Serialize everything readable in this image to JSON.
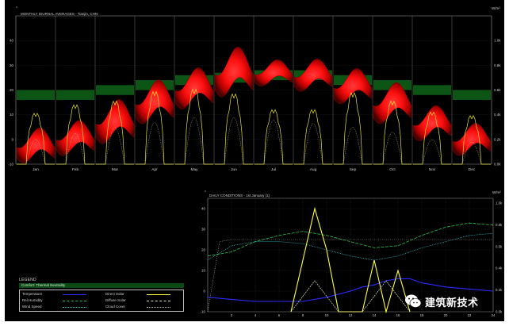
{
  "screen": {
    "background": "#000000",
    "frame": "#ffffff",
    "text": "#bdbdbd",
    "grid": "#3a3a3a"
  },
  "top": {
    "title": "MONTHLY DIURNAL AVERAGES - Tianjin, CHN",
    "left_unit": "°",
    "right_unit": "W/m²",
    "comfort_color": "#0d5a16"
  },
  "bottom": {
    "title": "DAILY CONDITIONS - 1st January (1)",
    "left_unit": "°",
    "right_unit": "W/m²"
  },
  "legend": {
    "title": "LEGEND",
    "comfort_label": "Comfort: Thermal Neutrality",
    "items": {
      "temperature": "Temperature",
      "rel_humidity": "Rel.Humidity",
      "wind_speed": "Wind Speed",
      "direct_solar": "Direct Solar",
      "diffuse_solar": "Diffuse Solar",
      "cloud_cover": "Cloud Cover"
    },
    "colors": {
      "temperature": "#2b2bff",
      "rel_humidity": "#2ec24a",
      "wind_speed": "#33c4c4",
      "direct_solar": "#ffff33",
      "diffuse_solar": "#e6e6b4",
      "cloud_cover": "#b8b8b8"
    }
  },
  "watermark": {
    "text": "建筑新技术",
    "icon": "wechat-icon"
  },
  "chart_data": [
    {
      "type": "area",
      "title": "MONTHLY DIURNAL AVERAGES - Tianjin, CHN",
      "y_ticks": [
        -10,
        0,
        10,
        20,
        30,
        40
      ],
      "y_range": [
        -10,
        50
      ],
      "y2_ticks": [
        "0.0k",
        "0.2k",
        "0.4k",
        "0.6k",
        "0.8k",
        "1.0k"
      ],
      "y2_range": [
        0,
        1.2
      ],
      "categories": [
        "Jan",
        "Feb",
        "Mar",
        "Apr",
        "May",
        "Jun",
        "Jul",
        "Aug",
        "Sep",
        "Oct",
        "Nov",
        "Dec"
      ],
      "comfort_band": [
        [
          16,
          20
        ],
        [
          16,
          20
        ],
        [
          18,
          22
        ],
        [
          20,
          24
        ],
        [
          22,
          26
        ],
        [
          23,
          27
        ],
        [
          24,
          28
        ],
        [
          24,
          28
        ],
        [
          22,
          26
        ],
        [
          20,
          24
        ],
        [
          18,
          22
        ],
        [
          16,
          20
        ]
      ],
      "temperature_range": [
        [
          -9,
          3
        ],
        [
          -6,
          6
        ],
        [
          -1,
          14
        ],
        [
          7,
          22
        ],
        [
          13,
          27
        ],
        [
          18,
          35
        ],
        [
          22,
          31
        ],
        [
          20,
          31
        ],
        [
          15,
          27
        ],
        [
          7,
          21
        ],
        [
          0,
          12
        ],
        [
          -6,
          5
        ]
      ],
      "direct_solar_peak_kwm2": [
        0.42,
        0.49,
        0.52,
        0.6,
        0.62,
        0.58,
        0.45,
        0.45,
        0.59,
        0.52,
        0.43,
        0.4
      ],
      "diffuse_solar_peak_kwm2": [
        0.2,
        0.25,
        0.3,
        0.34,
        0.38,
        0.38,
        0.36,
        0.33,
        0.3,
        0.26,
        0.2,
        0.18
      ]
    },
    {
      "type": "line",
      "title": "DAILY CONDITIONS - 1st January (1)",
      "x_ticks": [
        2,
        4,
        6,
        8,
        10,
        12,
        14,
        16,
        18,
        20,
        22,
        24
      ],
      "x_range": [
        0,
        24
      ],
      "y_ticks": [
        -10,
        0,
        10,
        20,
        30,
        40
      ],
      "y_range": [
        -10,
        45
      ],
      "y2_ticks": [
        "0.0k",
        "0.2k",
        "0.4k",
        "0.6k",
        "0.8k",
        "1.0k"
      ],
      "series": [
        {
          "name": "Temperature",
          "x": [
            0,
            2,
            4,
            6,
            8,
            10,
            12,
            13,
            14,
            15,
            16,
            17,
            18,
            20,
            22,
            24
          ],
          "y": [
            -3,
            -4,
            -5,
            -5,
            -5,
            -3,
            0,
            2,
            3,
            5,
            6,
            6,
            4,
            2,
            1,
            0
          ]
        },
        {
          "name": "Rel.Humidity",
          "x": [
            0,
            2,
            4,
            6,
            8,
            10,
            12,
            14,
            16,
            18,
            20,
            22,
            24
          ],
          "y": [
            17,
            19,
            24,
            27,
            29,
            27,
            24,
            21,
            22,
            27,
            31,
            33,
            32
          ]
        },
        {
          "name": "Wind Speed",
          "x": [
            0,
            2,
            4,
            6,
            8,
            10,
            12,
            14,
            16,
            18,
            20,
            22,
            24
          ],
          "y": [
            15,
            22,
            24,
            24,
            23,
            20,
            17,
            15,
            17,
            21,
            24,
            27,
            28
          ]
        },
        {
          "name": "Direct Solar",
          "x": [
            7,
            8,
            9,
            10,
            11,
            12,
            13,
            14,
            15,
            16,
            17
          ],
          "y": [
            -10,
            15,
            40,
            20,
            -10,
            -10,
            -10,
            15,
            -10,
            10,
            -10
          ]
        },
        {
          "name": "Diffuse Solar",
          "x": [
            7,
            9,
            11,
            13,
            15,
            17
          ],
          "y": [
            -10,
            5,
            -10,
            -10,
            5,
            -10
          ]
        },
        {
          "name": "Cloud Cover",
          "x": [
            0,
            1,
            2,
            24
          ],
          "y": [
            -10,
            24,
            25,
            25
          ]
        }
      ]
    }
  ]
}
